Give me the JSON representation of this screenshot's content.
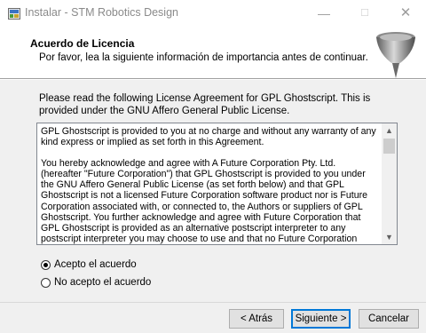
{
  "window": {
    "title": "Instalar - STM Robotics Design",
    "minimize_glyph": "—",
    "maximize_glyph": "☐",
    "close_glyph": "✕",
    "icon": "installer-icon"
  },
  "header": {
    "title": "Acuerdo de Licencia",
    "subtitle": "Por favor, lea la siguiente información de importancia antes de continuar.",
    "logo_icon": "robot-tool-logo"
  },
  "main": {
    "intro": "Please read the following License Agreement for GPL Ghostscript. This is provided under the GNU Affero General Public License.",
    "license_paragraphs": [
      "GPL Ghostscript is provided to you at no charge and without any warranty of any\nkind express or implied as set forth in this Agreement.",
      "You hereby acknowledge and agree with A Future Corporation Pty. Ltd.\n(hereafter \"Future Corporation\") that GPL Ghostscript is provided to you under\nthe GNU Affero General Public License (as set forth below) and that GPL\nGhostscript is not a licensed Future Corporation software product nor is Future\nCorporation associated with, or connected to, the Authors or suppliers of GPL\nGhostscript. You further acknowledge and agree with Future Corporation that\nGPL Ghostscript is provided as an alternative postscript interpreter to any\npostscript interpreter you may choose to use and that no Future Corporation"
    ],
    "scroll_up_glyph": "▲",
    "scroll_down_glyph": "▼",
    "radio_accept": "Acepto el acuerdo",
    "radio_decline": "No acepto el acuerdo",
    "selected": "accept"
  },
  "footer": {
    "back_label": "< Atrás",
    "next_label": "Siguiente >",
    "cancel_label": "Cancelar"
  }
}
